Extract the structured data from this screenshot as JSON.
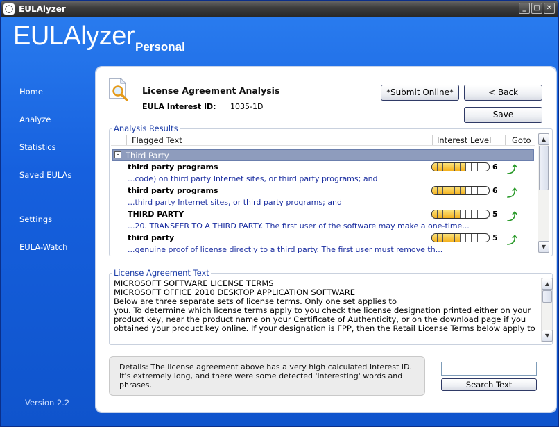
{
  "window": {
    "title": "EULAlyzer",
    "title_icon": "eulalyzer-app-icon",
    "controls": [
      "minimize",
      "maximize",
      "close"
    ]
  },
  "brand": {
    "main": "EULAlyzer",
    "sub": "Personal"
  },
  "sidebar": {
    "items": [
      {
        "label": "Home"
      },
      {
        "label": "Analyze"
      },
      {
        "label": "Statistics"
      },
      {
        "label": "Saved EULAs"
      },
      {
        "label": "Settings"
      },
      {
        "label": "EULA-Watch"
      }
    ],
    "version": "Version 2.2"
  },
  "panel": {
    "heading": "License Agreement Analysis",
    "eula_id_label": "EULA Interest ID:",
    "eula_id_value": "1035-1D",
    "buttons": {
      "submit": "*Submit Online*",
      "back": "< Back",
      "save": "Save"
    }
  },
  "results": {
    "group_label": "Analysis Results",
    "columns": {
      "flagged": "Flagged Text",
      "interest": "Interest Level",
      "goto": "Goto"
    },
    "category": "Third Party",
    "rows": [
      {
        "term": "third party programs",
        "snippet": "...code) on third party Internet sites, or third party programs; and",
        "level": 6,
        "score": "6"
      },
      {
        "term": "third party programs",
        "snippet": "...third party Internet sites, or third party programs; and",
        "level": 6,
        "score": "6"
      },
      {
        "term": "THIRD PARTY",
        "snippet": "...20. TRANSFER TO A THIRD PARTY. The first user of the software may make a one-time...",
        "level": 5,
        "score": "5"
      },
      {
        "term": "third party",
        "snippet": "...genuine proof of license directly to a third party. The first user must remove th...",
        "level": 5,
        "score": "5"
      }
    ],
    "level_max": 10,
    "meter_color": "#f4b11d"
  },
  "license": {
    "group_label": "License Agreement Text",
    "lines": [
      "MICROSOFT SOFTWARE LICENSE TERMS",
      "MICROSOFT OFFICE 2010 DESKTOP APPLICATION SOFTWARE",
      "Below are three separate sets of license terms. Only one set applies to",
      "you. To determine which license terms apply to you check the license designation printed either on your",
      "product key, near the product name on your Certificate of Authenticity, or on the download page if you",
      "obtained your product key online. If your designation is FPP, then the Retail License Terms below apply to"
    ]
  },
  "details": {
    "text": "Details: The license agreement above has a very high calculated Interest ID. It's extremely long, and there were some detected 'interesting' words and phrases."
  },
  "search": {
    "value": "",
    "button": "Search Text"
  }
}
